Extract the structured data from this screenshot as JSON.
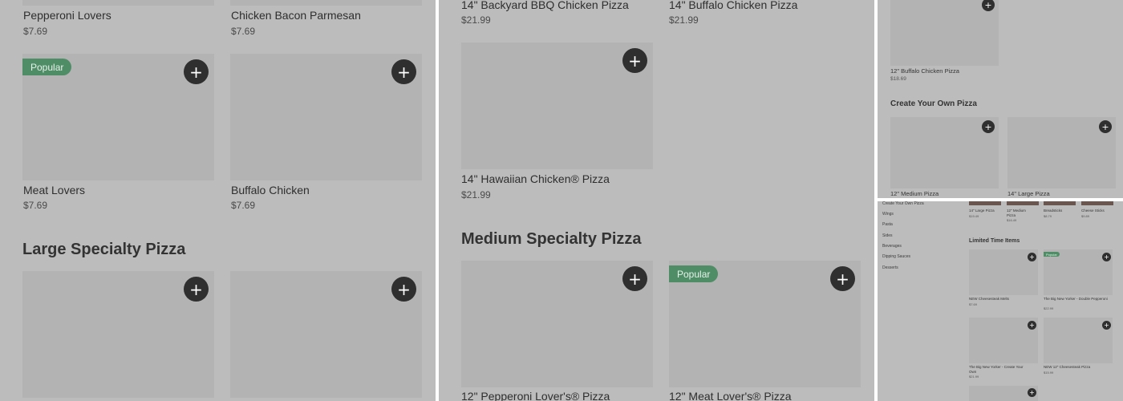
{
  "panel1": {
    "top_items": [
      {
        "name": "Pepperoni Lovers",
        "price": "$7.69"
      },
      {
        "name": "Chicken Bacon Parmesan",
        "price": "$7.69"
      }
    ],
    "items": [
      {
        "name": "Meat Lovers",
        "price": "$7.69",
        "badge": "Popular"
      },
      {
        "name": "Buffalo Chicken",
        "price": "$7.69"
      }
    ],
    "section_title": "Large Specialty Pizza"
  },
  "panel2": {
    "top_items": [
      {
        "name": "14\" Backyard BBQ Chicken Pizza",
        "price": "$21.99"
      },
      {
        "name": "14\" Buffalo Chicken Pizza",
        "price": "$21.99"
      }
    ],
    "item": {
      "name": "14\" Hawaiian Chicken® Pizza",
      "price": "$21.99"
    },
    "section_title": "Medium Specialty Pizza",
    "bottom_items": [
      {
        "name": "12\" Pepperoni Lover's® Pizza"
      },
      {
        "name": "12\" Meat Lover's® Pizza",
        "badge": "Popular"
      }
    ]
  },
  "panel3": {
    "item": {
      "name": "12\" Buffalo Chicken Pizza",
      "price": "$18.69"
    },
    "section_title": "Create Your Own Pizza",
    "items": [
      {
        "name": "12\" Medium Pizza"
      },
      {
        "name": "14\" Large Pizza"
      }
    ]
  },
  "panel4": {
    "nav": [
      "Create Your Own Pizza",
      "Wings",
      "Pasta",
      "Sides",
      "Beverages",
      "Dipping Sauces",
      "Desserts"
    ],
    "top_items": [
      {
        "name": "14\" Large Pizza",
        "price": "$19.49"
      },
      {
        "name": "12\" Medium Pizza",
        "price": "$16.49"
      },
      {
        "name": "Breadsticks",
        "price": "$8.79"
      },
      {
        "name": "Cheese Sticks",
        "price": "$9.89"
      }
    ],
    "section_title": "Limited Time Items",
    "items": [
      {
        "name": "NEW Cheesesteak Melts",
        "price": "$7.69"
      },
      {
        "name": "The Big New Yorker - Double Pepperoni",
        "price": "$22.99",
        "badge": "Popular"
      },
      {
        "name": "The Big New Yorker - Create Your Own",
        "price": "$21.99"
      },
      {
        "name": "NEW 12\" Cheesesteak Pizza",
        "price": "$15.99"
      }
    ]
  },
  "add_symbol": "+",
  "colors": {
    "badge": "#4e8d66",
    "add_button": "#2f2f2f",
    "image_placeholder": "#b3b3b3",
    "overlay": "#bcbcbc"
  }
}
